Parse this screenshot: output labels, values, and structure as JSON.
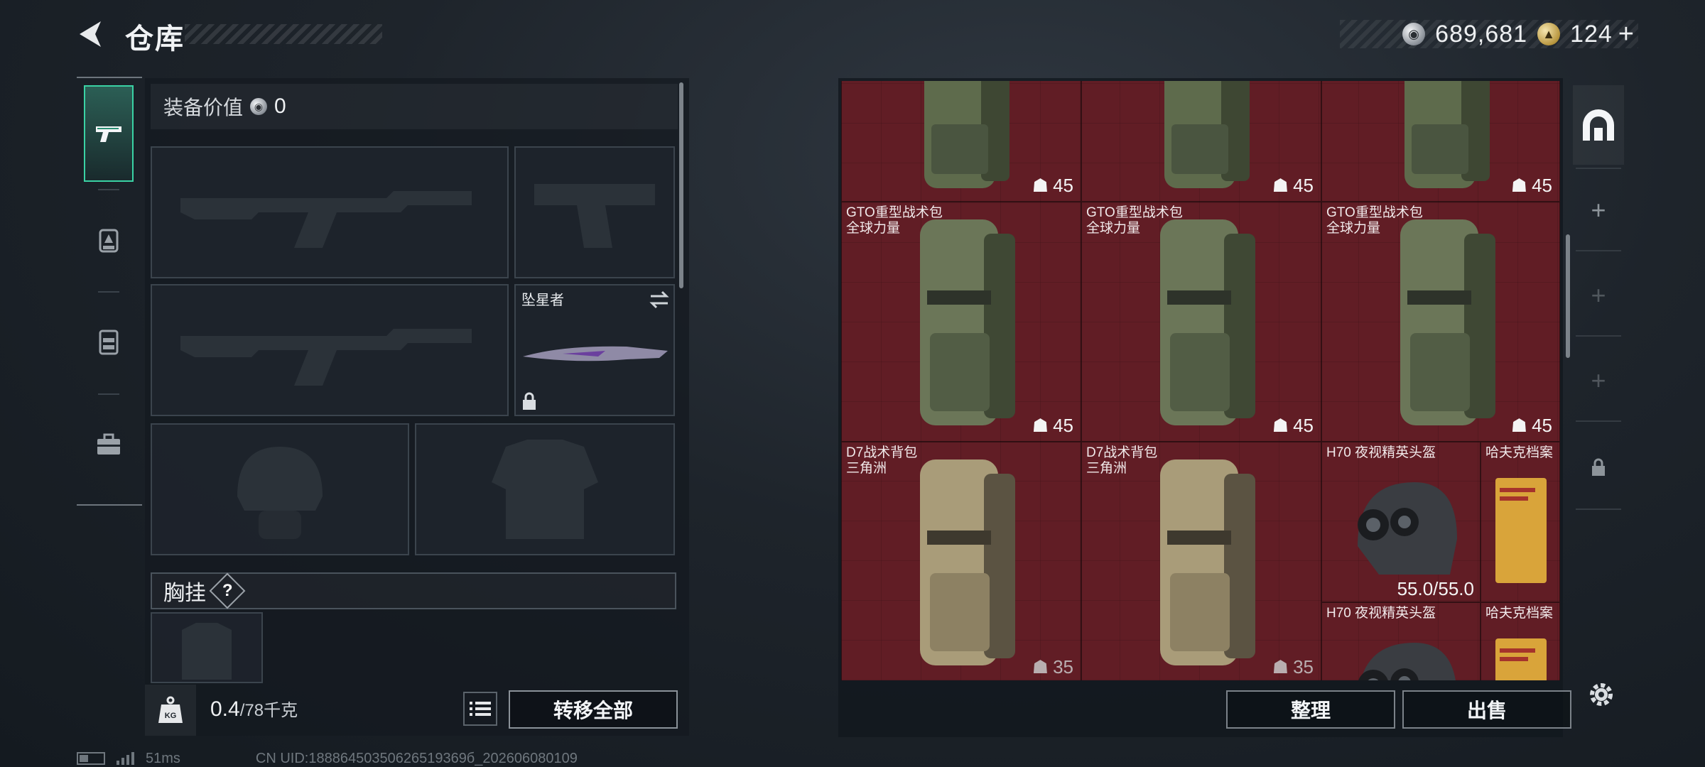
{
  "header": {
    "title": "仓库",
    "currency": [
      {
        "icon": "silver-coin-icon",
        "value": "689,681"
      },
      {
        "icon": "gold-coin-icon",
        "value": "124"
      }
    ],
    "add_label": "+"
  },
  "left_nav": {
    "items": [
      "pistol-icon",
      "backpack-lock-icon",
      "chest-rig-icon",
      "toolbox-icon"
    ],
    "active": 0
  },
  "equipment": {
    "value_label": "装备价值",
    "value": "0",
    "melee_name": "坠星者",
    "chest_label": "胸挂",
    "help": "?"
  },
  "weight": {
    "icon_text": "KG",
    "current": "0.4",
    "max": "/78千克"
  },
  "actions": {
    "transfer_all": "转移全部",
    "organize": "整理",
    "sell": "出售"
  },
  "storage": {
    "items": [
      {
        "name": "",
        "sub": "",
        "capacity": "45"
      },
      {
        "name": "",
        "sub": "",
        "capacity": "45"
      },
      {
        "name": "",
        "sub": "",
        "capacity": "45"
      },
      {
        "name": "GTO重型战术包",
        "sub": "全球力量",
        "capacity": "45"
      },
      {
        "name": "GTO重型战术包",
        "sub": "全球力量",
        "capacity": "45"
      },
      {
        "name": "GTO重型战术包",
        "sub": "全球力量",
        "capacity": "45"
      },
      {
        "name": "D7战术背包",
        "sub": "三角洲",
        "capacity": "35"
      },
      {
        "name": "D7战术背包",
        "sub": "三角洲",
        "capacity": "35"
      },
      {
        "name": "H70 夜视精英头盔",
        "durability": "55.0/55.0"
      },
      {
        "name": "哈夫克档案"
      },
      {
        "name": "H70 夜视精英头盔"
      },
      {
        "name": "哈夫克档案"
      }
    ]
  },
  "status": {
    "ping": "51ms",
    "uid": "CN UID:18886450350626519369б_202606080109"
  },
  "colors": {
    "accent": "#3ad2a4",
    "grid_bg": "#5b1e24"
  }
}
